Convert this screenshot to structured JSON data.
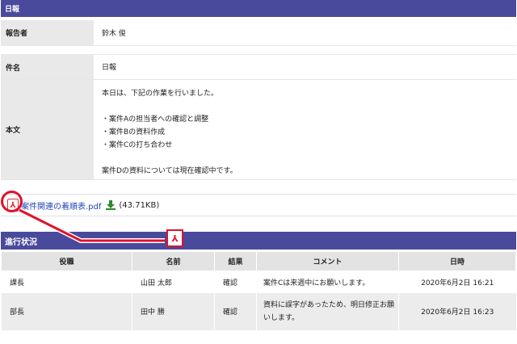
{
  "report": {
    "section_title": "日報",
    "reporter_label": "報告者",
    "reporter_value": "鈴木 俊",
    "subject_label": "件名",
    "subject_value": "日報",
    "body_label": "本文",
    "body_lines": [
      "本日は、下記の作業を行いました。",
      "",
      "・案件Aの担当者への確認と調整",
      "・案件Bの資料作成",
      "・案件Cの打ち合わせ",
      "",
      "案件Dの資料については現在確認中です。"
    ]
  },
  "attachment": {
    "icon": "pdf-icon",
    "filename": "案件関連の着順表.pdf",
    "download_icon": "download-icon",
    "size": "(43.71KB)"
  },
  "progress": {
    "section_title": "進行状況",
    "columns": [
      "役職",
      "名前",
      "結果",
      "コメント",
      "日時"
    ],
    "rows": [
      {
        "role": "課長",
        "name": "山田 太郎",
        "result": "確認",
        "comment": "案件Cは来週中にお願いします。",
        "datetime": "2020年6月2日 16:21"
      },
      {
        "role": "部長",
        "name": "田中 勝",
        "result": "確認",
        "comment": "資料に誤字があったため、明日修正お願いします。",
        "datetime": "2020年6月2日 16:23"
      }
    ]
  },
  "colors": {
    "header_bar": "#4a4a9c",
    "annotation": "#e0112b",
    "link": "#2244bb"
  }
}
